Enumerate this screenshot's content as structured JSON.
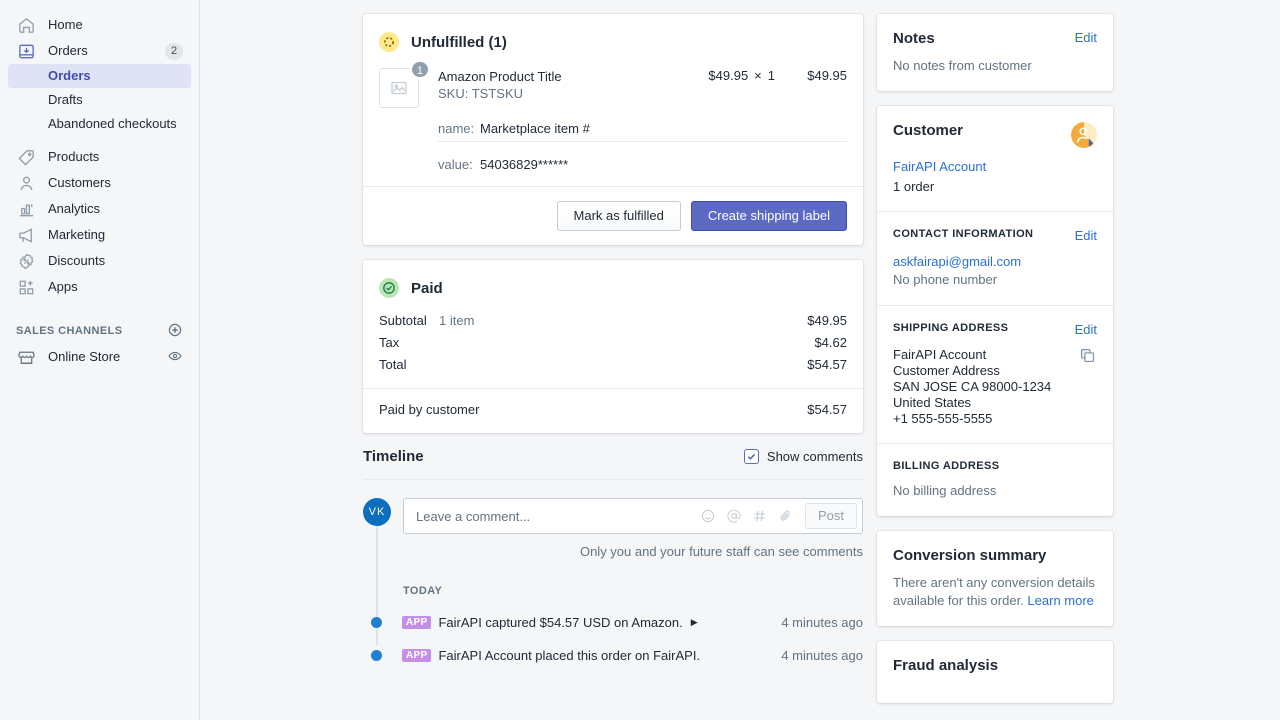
{
  "sidebar": {
    "items": [
      {
        "label": "Home",
        "icon": "home-icon",
        "badge": ""
      },
      {
        "label": "Orders",
        "icon": "orders-icon",
        "badge": "2"
      },
      {
        "label": "Products",
        "icon": "products-icon",
        "badge": ""
      },
      {
        "label": "Customers",
        "icon": "customers-icon",
        "badge": ""
      },
      {
        "label": "Analytics",
        "icon": "analytics-icon",
        "badge": ""
      },
      {
        "label": "Marketing",
        "icon": "marketing-icon",
        "badge": ""
      },
      {
        "label": "Discounts",
        "icon": "discounts-icon",
        "badge": ""
      },
      {
        "label": "Apps",
        "icon": "apps-icon",
        "badge": ""
      }
    ],
    "orders_sub": [
      {
        "label": "Orders",
        "active": true
      },
      {
        "label": "Drafts",
        "active": false
      },
      {
        "label": "Abandoned checkouts",
        "active": false
      }
    ],
    "sales_channels": {
      "heading": "SALES CHANNELS",
      "add_icon": "plus-circle-icon",
      "items": [
        {
          "label": "Online Store",
          "icon": "store-icon",
          "trailing_icon": "eye-icon"
        }
      ]
    }
  },
  "fulfillment": {
    "status_icon": "unfulfilled-icon",
    "title": "Unfulfilled (1)",
    "item": {
      "thumb_icon": "image-placeholder-icon",
      "quantity_badge": "1",
      "name": "Amazon Product Title",
      "sku": "SKU: TSTSKU",
      "unit_price": "$49.95",
      "multiply": "×",
      "quantity": "1",
      "line_total": "$49.95",
      "properties": [
        {
          "key": "name:",
          "value": "Marketplace item #"
        },
        {
          "key": "value:",
          "value": "54036829******"
        }
      ]
    },
    "actions": {
      "secondary": "Mark as fulfilled",
      "primary": "Create shipping label"
    }
  },
  "payment": {
    "status_icon": "paid-icon",
    "title": "Paid",
    "rows": [
      {
        "label": "Subtotal",
        "sub": "1 item",
        "value": "$49.95"
      },
      {
        "label": "Tax",
        "sub": "",
        "value": "$4.62"
      },
      {
        "label": "Total",
        "sub": "",
        "value": "$54.57"
      }
    ],
    "paid_by": {
      "label": "Paid by customer",
      "value": "$54.57"
    }
  },
  "timeline": {
    "title": "Timeline",
    "show_comments_label": "Show comments",
    "show_comments_checked": true,
    "avatar_initials": "VK",
    "comment_placeholder": "Leave a comment...",
    "comment_value": "",
    "toolbar_icons": [
      "emoji-icon",
      "mention-icon",
      "hashtag-icon",
      "attachment-icon"
    ],
    "post_label": "Post",
    "hint": "Only you and your future staff can see comments",
    "day_label": "TODAY",
    "events": [
      {
        "badge": "APP",
        "text": "FairAPI captured $54.57 USD on Amazon.",
        "expandable": true,
        "time": "4 minutes ago"
      },
      {
        "badge": "APP",
        "text": "FairAPI Account placed this order on FairAPI.",
        "expandable": false,
        "time": "4 minutes ago"
      }
    ]
  },
  "notes": {
    "title": "Notes",
    "edit_label": "Edit",
    "body": "No notes from customer"
  },
  "customer": {
    "title": "Customer",
    "avatar_icon": "customer-avatar-icon",
    "name": "FairAPI Account",
    "order_count": "1 order",
    "contact": {
      "heading": "CONTACT INFORMATION",
      "edit_label": "Edit",
      "email": "askfairapi@gmail.com",
      "phone": "No phone number"
    },
    "shipping": {
      "heading": "SHIPPING ADDRESS",
      "edit_label": "Edit",
      "copy_icon": "copy-icon",
      "lines": [
        "FairAPI Account",
        "Customer Address",
        "SAN JOSE CA 98000-1234",
        "United States",
        "+1 555-555-5555"
      ]
    },
    "billing": {
      "heading": "BILLING ADDRESS",
      "body": "No billing address"
    }
  },
  "conversion": {
    "title": "Conversion summary",
    "body": "There aren't any conversion details available for this order.",
    "link": "Learn more"
  },
  "fraud": {
    "title": "Fraud analysis"
  },
  "colors": {
    "accent": "#5c6ac4",
    "link": "#2a6fd1",
    "warning": "#ffea8a",
    "success": "#bbe5b3",
    "app_badge": "#c58fe8",
    "timeline_dot": "#1f7fd1"
  }
}
